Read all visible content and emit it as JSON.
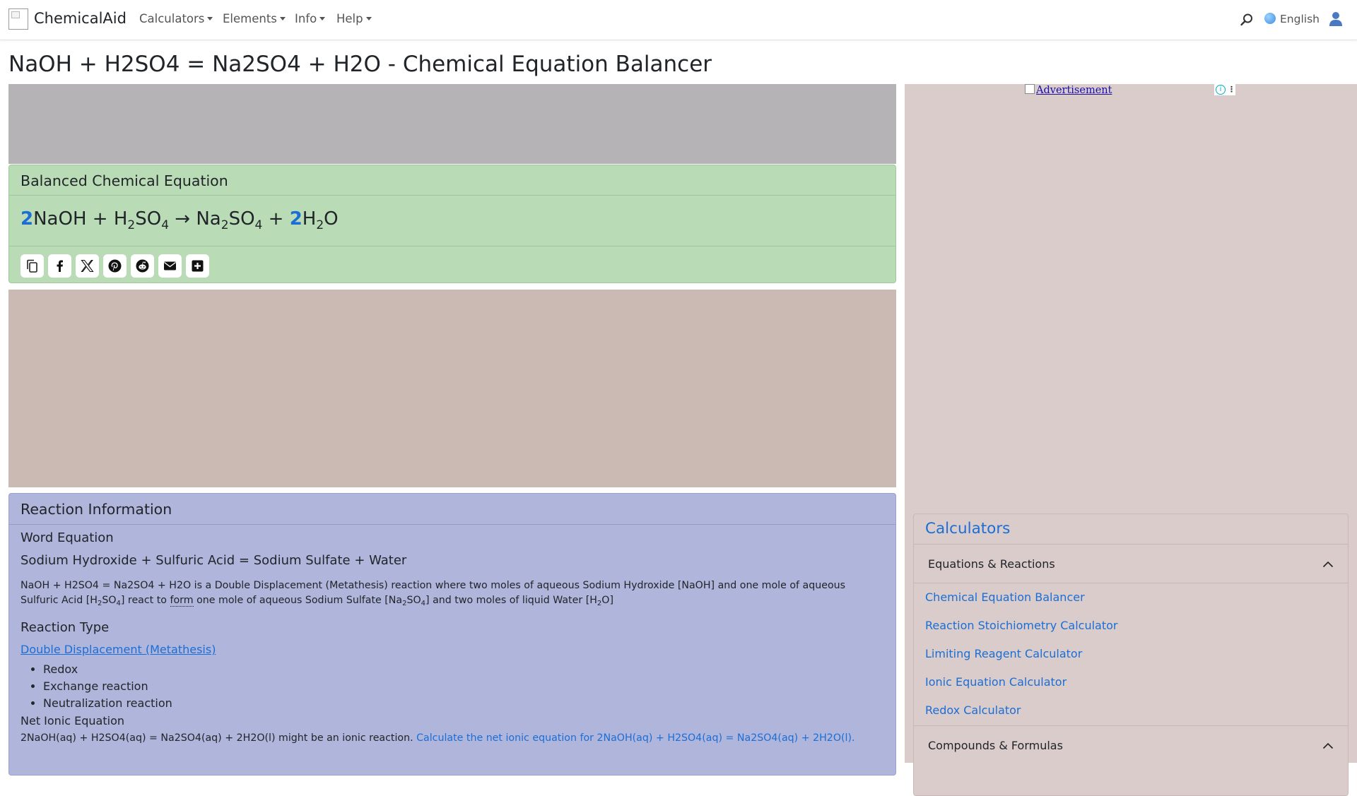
{
  "brand": {
    "name": "ChemicalAid"
  },
  "nav": {
    "items": [
      "Calculators",
      "Elements",
      "Info",
      "Help"
    ],
    "language": "English"
  },
  "page": {
    "title": "NaOH + H2SO4 = Na2SO4 + H2O - Chemical Equation Balancer"
  },
  "ad": {
    "label": "Advertisement"
  },
  "balanced": {
    "heading": "Balanced Chemical Equation",
    "equation": {
      "coef1": "2",
      "r1": "NaOH",
      "plus1": "+",
      "r2a": "H",
      "r2s1": "2",
      "r2b": "SO",
      "r2s2": "4",
      "arrow": "→",
      "p1a": "Na",
      "p1s1": "2",
      "p1b": "SO",
      "p1s2": "4",
      "plus2": "+",
      "coef2": "2",
      "p2a": "H",
      "p2s": "2",
      "p2b": "O"
    },
    "share_icons": [
      "copy-icon",
      "facebook-icon",
      "x-icon",
      "pinterest-icon",
      "reddit-icon",
      "email-icon",
      "plus-icon"
    ]
  },
  "info": {
    "heading": "Reaction Information",
    "word_equation_heading": "Word Equation",
    "word_equation": "Sodium Hydroxide + Sulfuric Acid = Sodium Sulfate + Water",
    "description": {
      "part1": "NaOH + H2SO4 = Na2SO4 + H2O is a Double Displacement (Metathesis) reaction where two moles of aqueous Sodium Hydroxide [NaOH] and one mole of aqueous Sulfuric Acid [H",
      "s1": "2",
      "part2": "SO",
      "s2": "4",
      "part3": "] react to ",
      "form_word": "form",
      "part4": " one mole of aqueous Sodium Sulfate [Na",
      "s3": "2",
      "part5": "SO",
      "s4": "4",
      "part6": "] and two moles of liquid Water [H",
      "s5": "2",
      "part7": "O]"
    },
    "reaction_type_heading": "Reaction Type",
    "reaction_type_link": "Double Displacement (Metathesis)",
    "reaction_types": [
      "Redox",
      "Exchange reaction",
      "Neutralization reaction"
    ],
    "net_ionic_heading": "Net Ionic Equation",
    "net_ionic_text": "2NaOH(aq) + H2SO4(aq) = Na2SO4(aq) + 2H2O(l) might be an ionic reaction.",
    "net_ionic_link": "Calculate the net ionic equation for 2NaOH(aq) + H2SO4(aq) = Na2SO4(aq) + 2H2O(l)."
  },
  "sidebar": {
    "title": "Calculators",
    "section1": "Equations & Reactions",
    "links": [
      "Chemical Equation Balancer",
      "Reaction Stoichiometry Calculator",
      "Limiting Reagent Calculator",
      "Ionic Equation Calculator",
      "Redox Calculator"
    ],
    "section2": "Compounds & Formulas"
  },
  "colors": {
    "link": "#1b6ed6",
    "balanced_card_bg": "#b9dbb6",
    "info_card_bg": "#b0b5db",
    "sidebar_bg": "#d9cccb"
  }
}
